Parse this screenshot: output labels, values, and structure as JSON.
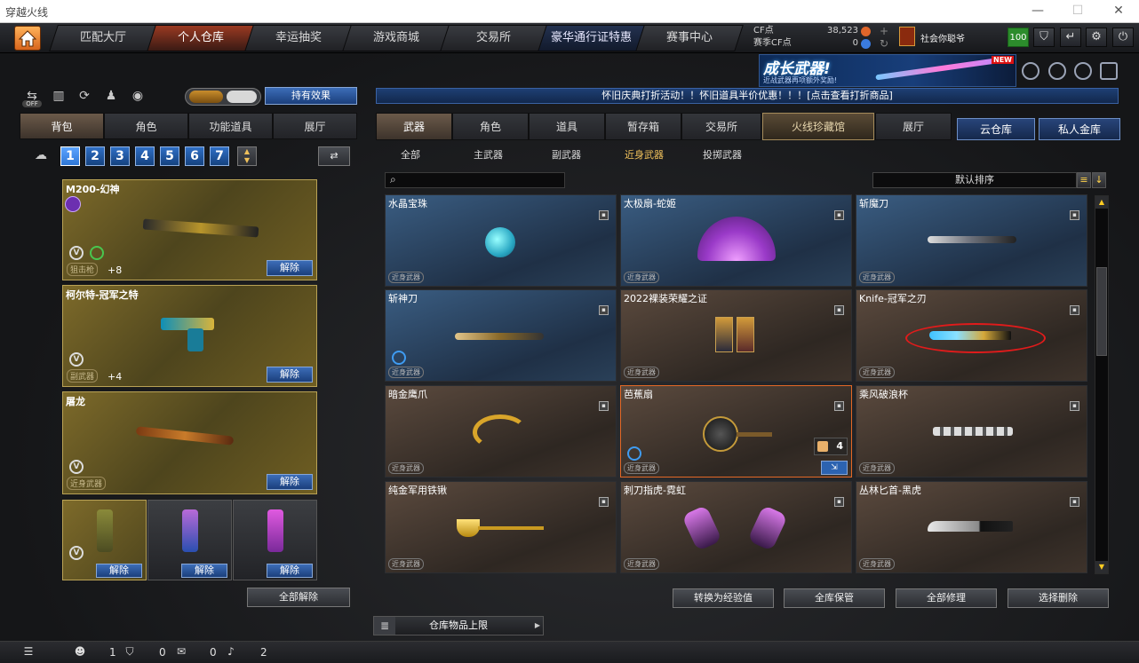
{
  "window": {
    "title": "穿越火线"
  },
  "nav": {
    "tabs": [
      "匹配大厅",
      "个人仓库",
      "幸运抽奖",
      "游戏商城",
      "交易所",
      "豪华通行证特惠",
      "赛事中心"
    ],
    "active_index": 1
  },
  "currency": {
    "cf_label": "CF点",
    "cf_value": "38,523",
    "season_label": "赛季CF点",
    "season_value": "0"
  },
  "user": {
    "name": "社会你聪爷",
    "level": "100"
  },
  "banner": {
    "title": "成长武器!",
    "subtitle": "近战武器再项额外奖励!",
    "badge": "NEW"
  },
  "left": {
    "toggle_off_label": "OFF",
    "effects_button": "持有效果",
    "tabs": [
      "背包",
      "角色",
      "功能道具",
      "展厅"
    ],
    "pages": [
      "1",
      "2",
      "3",
      "4",
      "5",
      "6",
      "7"
    ],
    "slots": [
      {
        "name": "M200-幻神",
        "category": "狙击枪",
        "bonus": "+8",
        "action": "解除"
      },
      {
        "name": "柯尔特-冠军之特",
        "category": "副武器",
        "bonus": "+4",
        "action": "解除"
      },
      {
        "name": "屠龙",
        "category": "近身武器",
        "bonus": "",
        "action": "解除"
      }
    ],
    "throwables": [
      {
        "action": "解除"
      },
      {
        "action": "解除"
      },
      {
        "action": "解除"
      }
    ],
    "remove_all": "全部解除"
  },
  "right": {
    "promo": "怀旧庆典打折活动！！怀旧道具半价优惠！！！[点击查看打折商品]",
    "tabs": [
      "武器",
      "角色",
      "道具",
      "暂存箱",
      "交易所",
      "火线珍藏馆",
      "展厅"
    ],
    "storage_tabs": [
      "云仓库",
      "私人金库"
    ],
    "subtabs": [
      "全部",
      "主武器",
      "副武器",
      "近身武器",
      "投掷武器"
    ],
    "active_subtab": 3,
    "search_placeholder": "",
    "sort_label": "默认排序",
    "items": [
      {
        "name": "水晶宝珠",
        "category": "近身武器"
      },
      {
        "name": "太极扇-蛇姬",
        "category": "近身武器"
      },
      {
        "name": "斩魔刀",
        "category": "近身武器"
      },
      {
        "name": "斩神刀",
        "category": "近身武器"
      },
      {
        "name": "2022裸装荣耀之证",
        "category": "近身武器"
      },
      {
        "name": "Knife-冠军之刃",
        "category": "近身武器"
      },
      {
        "name": "暗金鹰爪",
        "category": "近身武器"
      },
      {
        "name": "芭蕉扇",
        "category": "近身武器",
        "qty": "4"
      },
      {
        "name": "乘风破浪杯",
        "category": "近身武器"
      },
      {
        "name": "纯金军用铁锹",
        "category": "近身武器"
      },
      {
        "name": "刺刀指虎-霓虹",
        "category": "近身武器"
      },
      {
        "name": "丛林匕首-黑虎",
        "category": "近身武器"
      }
    ],
    "bottom_buttons": [
      "转换为经验值",
      "全库保管",
      "全部修理",
      "选择删除"
    ],
    "storage_limit": "仓库物品上限"
  },
  "status": {
    "friends": "1",
    "clan": "0",
    "chat": "0",
    "voice": "2"
  }
}
